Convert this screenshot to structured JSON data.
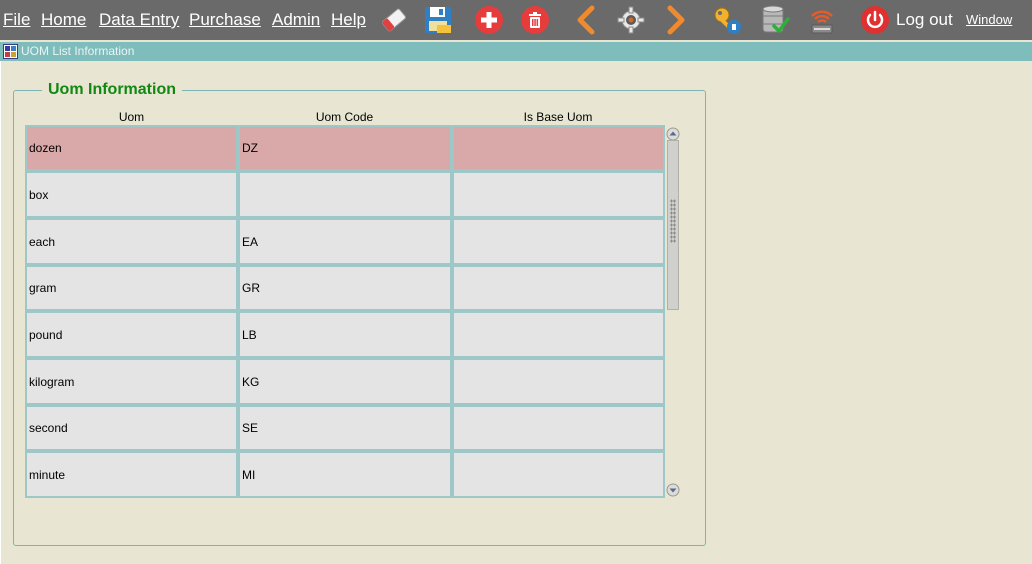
{
  "menubar": {
    "items": [
      {
        "label": "File"
      },
      {
        "label": "Home"
      },
      {
        "label": "Data Entry"
      },
      {
        "label": "Purchase"
      },
      {
        "label": "Admin"
      },
      {
        "label": "Help"
      }
    ],
    "toolbar_icons": [
      "eraser-icon",
      "save-icon",
      "add-icon",
      "delete-icon",
      "back-icon",
      "settings-icon",
      "forward-icon",
      "key-icon",
      "database-icon",
      "network-icon",
      "power-icon"
    ],
    "logout_label": "Log out",
    "window_label": "Window"
  },
  "window": {
    "title": "UOM List Information"
  },
  "group": {
    "title": "Uom Information"
  },
  "table": {
    "columns": [
      "Uom",
      "Uom Code",
      "Is Base Uom"
    ],
    "rows": [
      {
        "uom": "dozen",
        "code": "DZ",
        "is_base": "",
        "selected": true
      },
      {
        "uom": "box",
        "code": "",
        "is_base": ""
      },
      {
        "uom": "each",
        "code": "EA",
        "is_base": ""
      },
      {
        "uom": "gram",
        "code": "GR",
        "is_base": ""
      },
      {
        "uom": "pound",
        "code": "LB",
        "is_base": ""
      },
      {
        "uom": "kilogram",
        "code": "KG",
        "is_base": ""
      },
      {
        "uom": "second",
        "code": "SE",
        "is_base": ""
      },
      {
        "uom": "minute",
        "code": "MI",
        "is_base": ""
      }
    ]
  },
  "colors": {
    "menubar_bg": "#6a6a6a",
    "title_strip_bg": "#7fbcbc",
    "selected_row": "#d9a8a8",
    "group_title": "#118811",
    "page_bg": "#e8e6d2"
  }
}
